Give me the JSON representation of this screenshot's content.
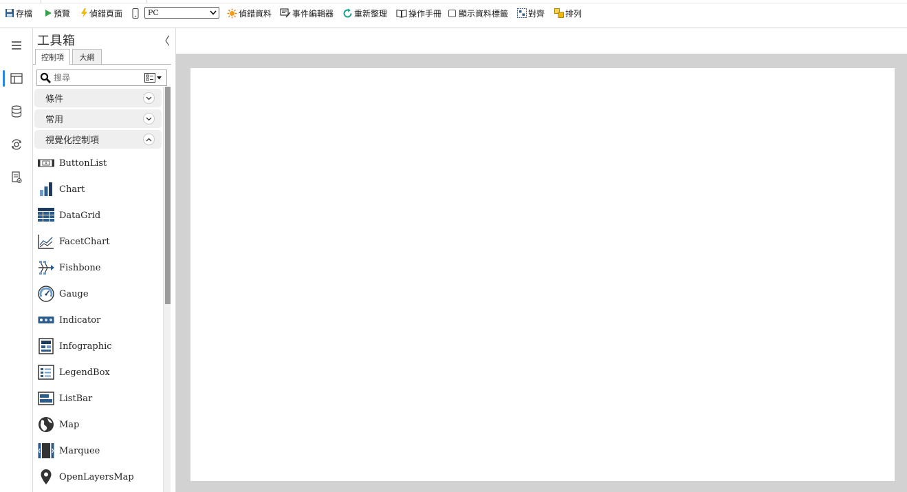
{
  "toolbar": {
    "save_label": "存檔",
    "preview_label": "預覽",
    "debug_page_label": "偵錯頁面",
    "device_value": "PC",
    "debug_data_label": "偵錯資料",
    "event_editor_label": "事件編輯器",
    "refresh_label": "重新整理",
    "manual_label": "操作手冊",
    "show_labels_label": "顯示資料標籤",
    "align_label": "對齊",
    "arrange_label": "排列"
  },
  "toolbox": {
    "title": "工具箱",
    "collapse_glyph": "〈",
    "tabs": [
      {
        "label": "控制項"
      },
      {
        "label": "大綱"
      }
    ],
    "search_placeholder": "搜尋",
    "groups": [
      {
        "label": "條件",
        "expanded": false
      },
      {
        "label": "常用",
        "expanded": false
      },
      {
        "label": "視覺化控制項",
        "expanded": true
      }
    ],
    "items": [
      {
        "label": "ButtonList",
        "icon": "buttonlist-icon"
      },
      {
        "label": "Chart",
        "icon": "chart-icon"
      },
      {
        "label": "DataGrid",
        "icon": "datagrid-icon"
      },
      {
        "label": "FacetChart",
        "icon": "facetchart-icon"
      },
      {
        "label": "Fishbone",
        "icon": "fishbone-icon"
      },
      {
        "label": "Gauge",
        "icon": "gauge-icon"
      },
      {
        "label": "Indicator",
        "icon": "indicator-icon"
      },
      {
        "label": "Infographic",
        "icon": "infographic-icon"
      },
      {
        "label": "LegendBox",
        "icon": "legendbox-icon"
      },
      {
        "label": "ListBar",
        "icon": "listbar-icon"
      },
      {
        "label": "Map",
        "icon": "map-icon"
      },
      {
        "label": "Marquee",
        "icon": "marquee-icon"
      },
      {
        "label": "OpenLayersMap",
        "icon": "openlayersmap-icon"
      }
    ]
  },
  "rail": {
    "icons": [
      "menu-icon",
      "layout-icon",
      "database-icon",
      "settings-sync-icon",
      "report-check-icon"
    ]
  },
  "colors": {
    "accent": "#2a86e6",
    "icon_blue": "#2d5b8a",
    "canvas_bg": "#d2d2d2"
  }
}
